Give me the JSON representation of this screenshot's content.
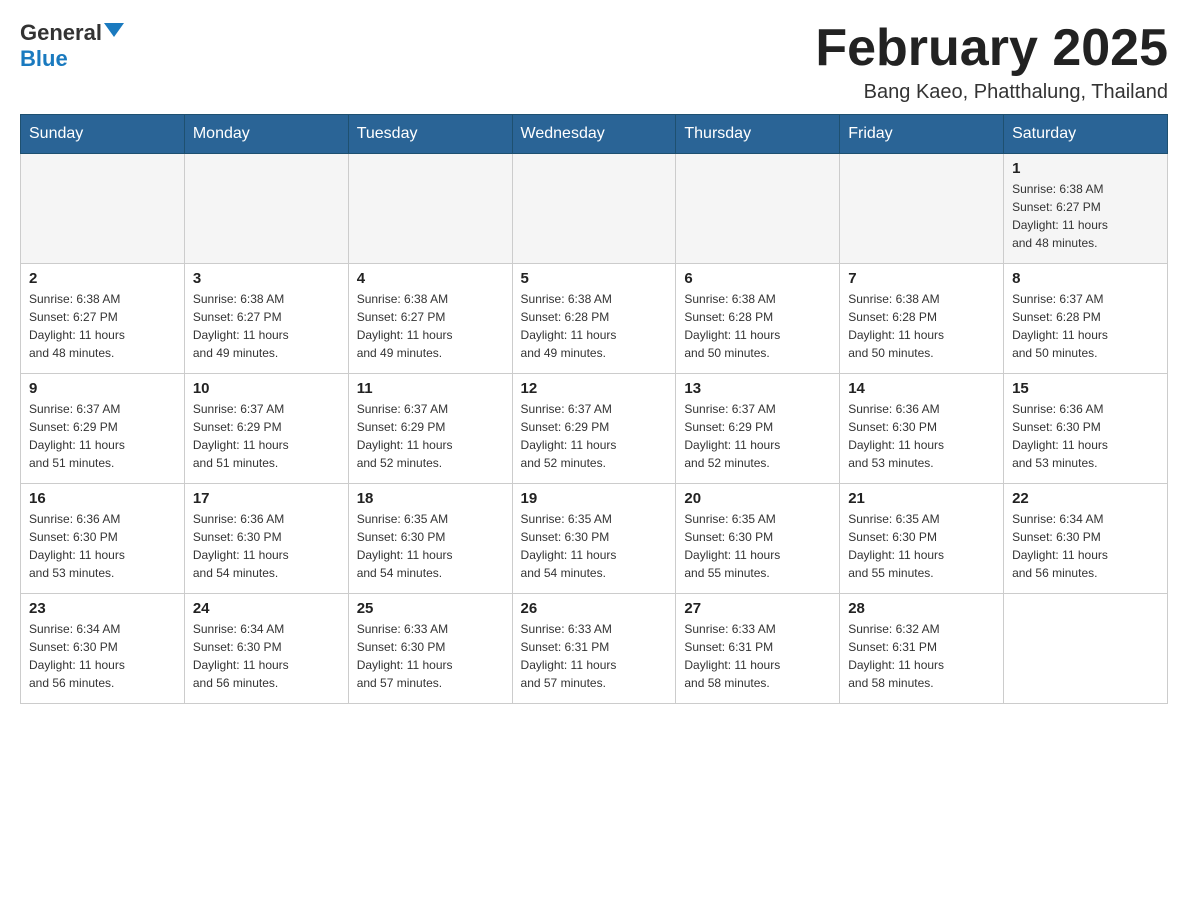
{
  "logo": {
    "general": "General",
    "blue": "Blue"
  },
  "title": "February 2025",
  "subtitle": "Bang Kaeo, Phatthalung, Thailand",
  "days_of_week": [
    "Sunday",
    "Monday",
    "Tuesday",
    "Wednesday",
    "Thursday",
    "Friday",
    "Saturday"
  ],
  "weeks": [
    [
      {
        "day": "",
        "info": ""
      },
      {
        "day": "",
        "info": ""
      },
      {
        "day": "",
        "info": ""
      },
      {
        "day": "",
        "info": ""
      },
      {
        "day": "",
        "info": ""
      },
      {
        "day": "",
        "info": ""
      },
      {
        "day": "1",
        "info": "Sunrise: 6:38 AM\nSunset: 6:27 PM\nDaylight: 11 hours\nand 48 minutes."
      }
    ],
    [
      {
        "day": "2",
        "info": "Sunrise: 6:38 AM\nSunset: 6:27 PM\nDaylight: 11 hours\nand 48 minutes."
      },
      {
        "day": "3",
        "info": "Sunrise: 6:38 AM\nSunset: 6:27 PM\nDaylight: 11 hours\nand 49 minutes."
      },
      {
        "day": "4",
        "info": "Sunrise: 6:38 AM\nSunset: 6:27 PM\nDaylight: 11 hours\nand 49 minutes."
      },
      {
        "day": "5",
        "info": "Sunrise: 6:38 AM\nSunset: 6:28 PM\nDaylight: 11 hours\nand 49 minutes."
      },
      {
        "day": "6",
        "info": "Sunrise: 6:38 AM\nSunset: 6:28 PM\nDaylight: 11 hours\nand 50 minutes."
      },
      {
        "day": "7",
        "info": "Sunrise: 6:38 AM\nSunset: 6:28 PM\nDaylight: 11 hours\nand 50 minutes."
      },
      {
        "day": "8",
        "info": "Sunrise: 6:37 AM\nSunset: 6:28 PM\nDaylight: 11 hours\nand 50 minutes."
      }
    ],
    [
      {
        "day": "9",
        "info": "Sunrise: 6:37 AM\nSunset: 6:29 PM\nDaylight: 11 hours\nand 51 minutes."
      },
      {
        "day": "10",
        "info": "Sunrise: 6:37 AM\nSunset: 6:29 PM\nDaylight: 11 hours\nand 51 minutes."
      },
      {
        "day": "11",
        "info": "Sunrise: 6:37 AM\nSunset: 6:29 PM\nDaylight: 11 hours\nand 52 minutes."
      },
      {
        "day": "12",
        "info": "Sunrise: 6:37 AM\nSunset: 6:29 PM\nDaylight: 11 hours\nand 52 minutes."
      },
      {
        "day": "13",
        "info": "Sunrise: 6:37 AM\nSunset: 6:29 PM\nDaylight: 11 hours\nand 52 minutes."
      },
      {
        "day": "14",
        "info": "Sunrise: 6:36 AM\nSunset: 6:30 PM\nDaylight: 11 hours\nand 53 minutes."
      },
      {
        "day": "15",
        "info": "Sunrise: 6:36 AM\nSunset: 6:30 PM\nDaylight: 11 hours\nand 53 minutes."
      }
    ],
    [
      {
        "day": "16",
        "info": "Sunrise: 6:36 AM\nSunset: 6:30 PM\nDaylight: 11 hours\nand 53 minutes."
      },
      {
        "day": "17",
        "info": "Sunrise: 6:36 AM\nSunset: 6:30 PM\nDaylight: 11 hours\nand 54 minutes."
      },
      {
        "day": "18",
        "info": "Sunrise: 6:35 AM\nSunset: 6:30 PM\nDaylight: 11 hours\nand 54 minutes."
      },
      {
        "day": "19",
        "info": "Sunrise: 6:35 AM\nSunset: 6:30 PM\nDaylight: 11 hours\nand 54 minutes."
      },
      {
        "day": "20",
        "info": "Sunrise: 6:35 AM\nSunset: 6:30 PM\nDaylight: 11 hours\nand 55 minutes."
      },
      {
        "day": "21",
        "info": "Sunrise: 6:35 AM\nSunset: 6:30 PM\nDaylight: 11 hours\nand 55 minutes."
      },
      {
        "day": "22",
        "info": "Sunrise: 6:34 AM\nSunset: 6:30 PM\nDaylight: 11 hours\nand 56 minutes."
      }
    ],
    [
      {
        "day": "23",
        "info": "Sunrise: 6:34 AM\nSunset: 6:30 PM\nDaylight: 11 hours\nand 56 minutes."
      },
      {
        "day": "24",
        "info": "Sunrise: 6:34 AM\nSunset: 6:30 PM\nDaylight: 11 hours\nand 56 minutes."
      },
      {
        "day": "25",
        "info": "Sunrise: 6:33 AM\nSunset: 6:30 PM\nDaylight: 11 hours\nand 57 minutes."
      },
      {
        "day": "26",
        "info": "Sunrise: 6:33 AM\nSunset: 6:31 PM\nDaylight: 11 hours\nand 57 minutes."
      },
      {
        "day": "27",
        "info": "Sunrise: 6:33 AM\nSunset: 6:31 PM\nDaylight: 11 hours\nand 58 minutes."
      },
      {
        "day": "28",
        "info": "Sunrise: 6:32 AM\nSunset: 6:31 PM\nDaylight: 11 hours\nand 58 minutes."
      },
      {
        "day": "",
        "info": ""
      }
    ]
  ]
}
